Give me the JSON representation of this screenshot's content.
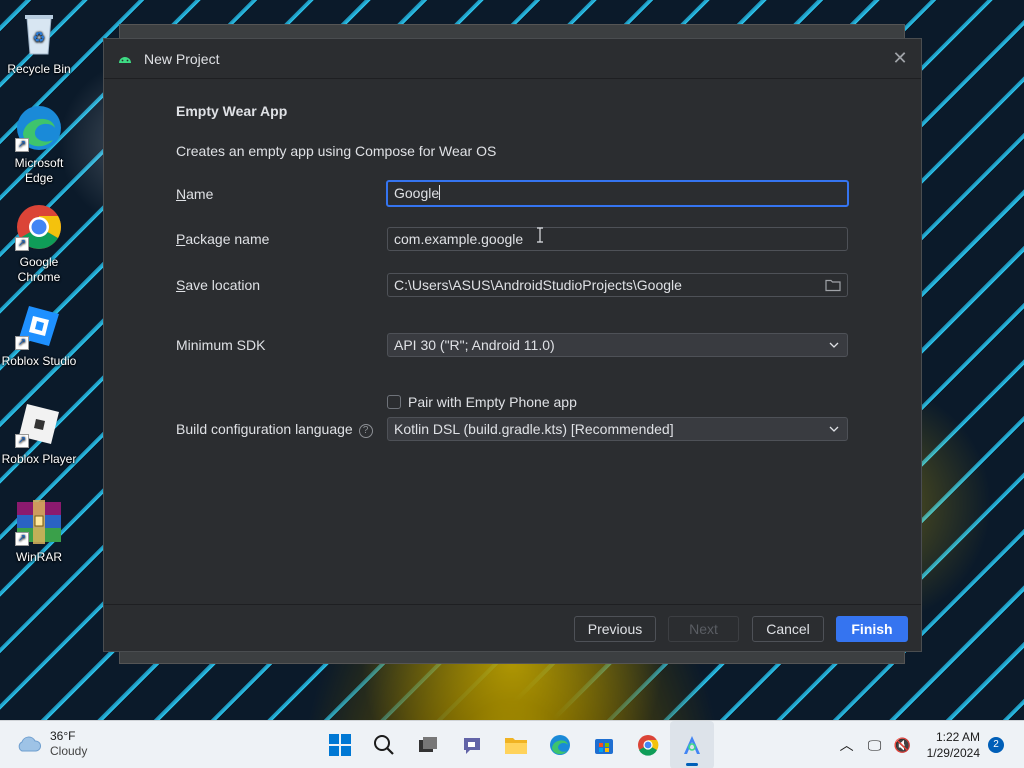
{
  "desktop": {
    "icons": [
      {
        "label": "Recycle Bin",
        "icon": "recycle-bin-icon"
      },
      {
        "label": "Microsoft Edge",
        "icon": "edge-icon"
      },
      {
        "label": "Google Chrome",
        "icon": "chrome-icon"
      },
      {
        "label": "Roblox Studio",
        "icon": "roblox-studio-icon"
      },
      {
        "label": "Roblox Player",
        "icon": "roblox-player-icon"
      },
      {
        "label": "WinRAR",
        "icon": "winrar-icon"
      }
    ]
  },
  "dialog": {
    "title": "New Project",
    "heading": "Empty Wear App",
    "description": "Creates an empty app using Compose for Wear OS",
    "fields": {
      "name": {
        "label_mnemonic": "N",
        "label_rest": "ame",
        "value": "Google"
      },
      "package": {
        "label_mnemonic": "P",
        "label_rest": "ackage name",
        "value": "com.example.google"
      },
      "save_location": {
        "label_mnemonic": "S",
        "label_rest": "ave location",
        "value": "C:\\Users\\ASUS\\AndroidStudioProjects\\Google"
      },
      "min_sdk": {
        "label": "Minimum SDK",
        "value": "API 30 (\"R\"; Android 11.0)"
      },
      "pair_phone": {
        "label": "Pair with Empty Phone app",
        "checked": false
      },
      "build_language": {
        "label": "Build configuration language",
        "value": "Kotlin DSL (build.gradle.kts) [Recommended]"
      }
    },
    "buttons": {
      "previous": "Previous",
      "next": "Next",
      "cancel": "Cancel",
      "finish": "Finish"
    },
    "accent_color": "#3574f0"
  },
  "taskbar": {
    "weather": {
      "temp": "36°F",
      "condition": "Cloudy"
    },
    "apps": [
      "start-icon",
      "search-icon",
      "task-view-icon",
      "chat-icon",
      "file-explorer-icon",
      "edge-icon",
      "store-icon",
      "chrome-icon",
      "android-studio-icon"
    ],
    "clock": {
      "time": "1:22 AM",
      "date": "1/29/2024"
    },
    "notifications": "2"
  }
}
